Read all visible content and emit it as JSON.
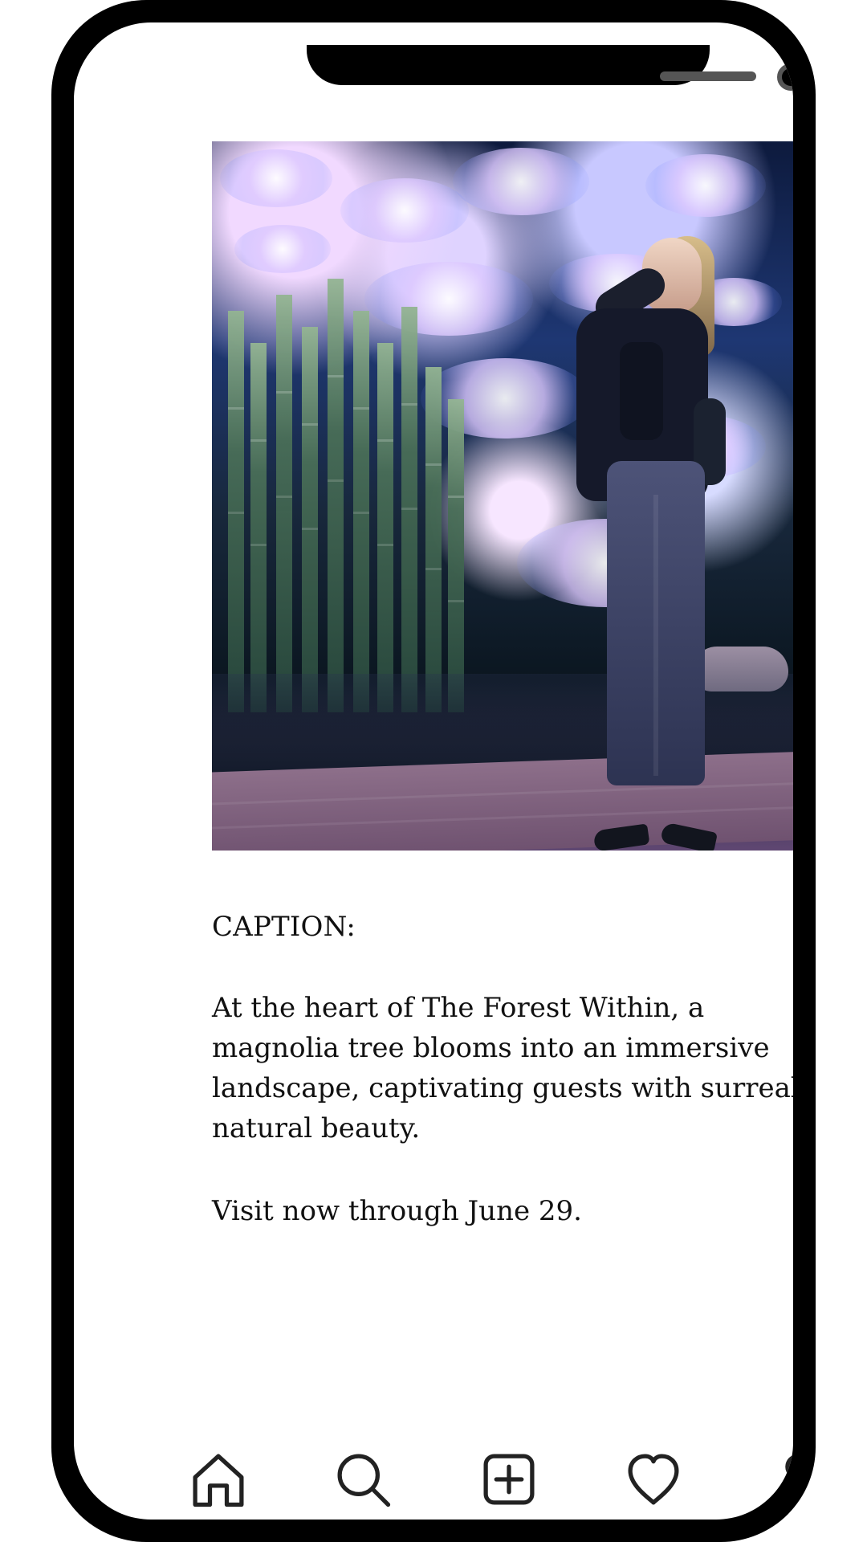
{
  "post": {
    "image_description": "",
    "caption_heading": "CAPTION:",
    "caption_body": "At the heart of The Forest Within, a magnolia tree blooms into an immersive landscape, captivating guests with surreal natural beauty.",
    "caption_dates": "Visit now through June 29."
  },
  "navigation": {
    "items": [
      {
        "icon": "home-icon"
      },
      {
        "icon": "search-icon"
      },
      {
        "icon": "add-post-icon"
      },
      {
        "icon": "heart-icon"
      },
      {
        "icon": "profile-icon"
      }
    ]
  },
  "colors": {
    "frame": "#000000",
    "screen": "#ffffff",
    "text": "#111111"
  }
}
